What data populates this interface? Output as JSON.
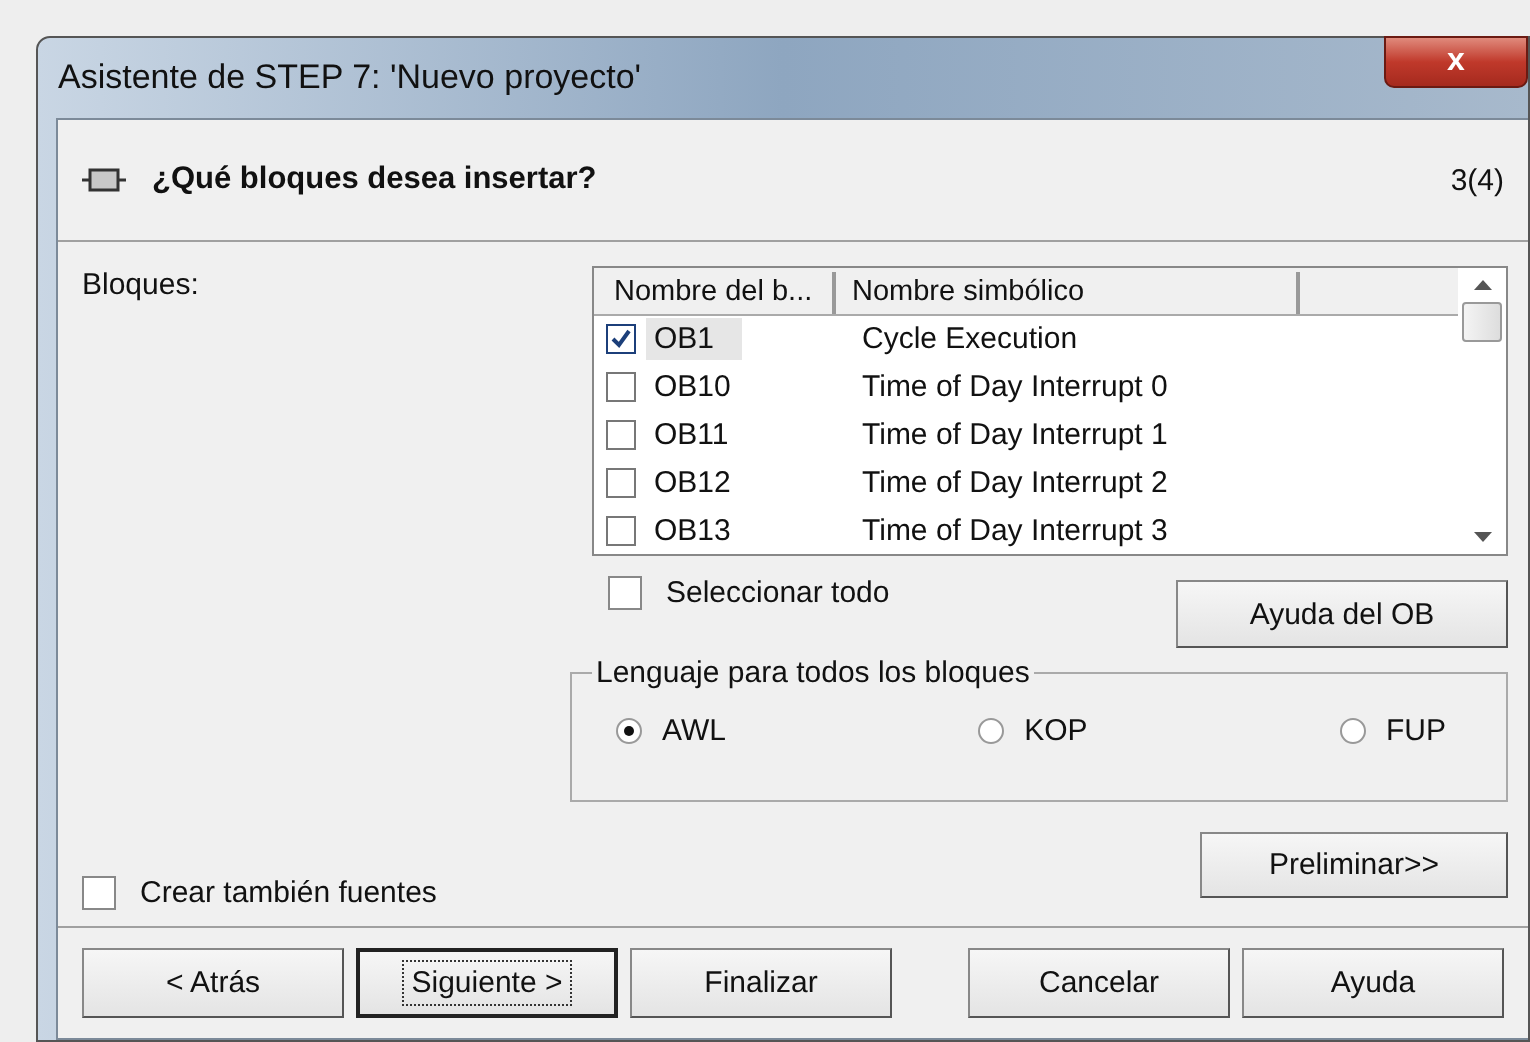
{
  "window": {
    "title": "Asistente de STEP 7: 'Nuevo proyecto'",
    "close": "x"
  },
  "header": {
    "title": "¿Qué bloques desea insertar?",
    "step": "3(4)"
  },
  "blocks_label": {
    "text": "Bloques:"
  },
  "table": {
    "columns": [
      "Nombre del b...",
      "Nombre simbólico"
    ],
    "rows": [
      {
        "name": "OB1",
        "symbol": "Cycle Execution",
        "checked": true,
        "selected": true
      },
      {
        "name": "OB10",
        "symbol": "Time of Day Interrupt 0",
        "checked": false,
        "selected": false
      },
      {
        "name": "OB11",
        "symbol": "Time of Day Interrupt 1",
        "checked": false,
        "selected": false
      },
      {
        "name": "OB12",
        "symbol": "Time of Day Interrupt 2",
        "checked": false,
        "selected": false
      },
      {
        "name": "OB13",
        "symbol": "Time of Day Interrupt 3",
        "checked": false,
        "selected": false
      }
    ]
  },
  "select_all": {
    "label": "Seleccionar todo",
    "checked": false
  },
  "ob_help": {
    "label": "Ayuda del OB"
  },
  "language": {
    "title": "Lenguaje para todos los bloques",
    "options": [
      {
        "label": "AWL",
        "selected": true
      },
      {
        "label": "KOP",
        "selected": false
      },
      {
        "label": "FUP",
        "selected": false
      }
    ]
  },
  "create_sources": {
    "label": "Crear también fuentes",
    "checked": false
  },
  "preview": {
    "label": "Preliminar>>"
  },
  "buttons": [
    {
      "label": "< Atrás",
      "default": false
    },
    {
      "label": "Siguiente >",
      "default": true
    },
    {
      "label": "Finalizar",
      "default": false
    },
    {
      "label": "Cancelar",
      "default": false
    },
    {
      "label": "Ayuda",
      "default": false
    }
  ]
}
